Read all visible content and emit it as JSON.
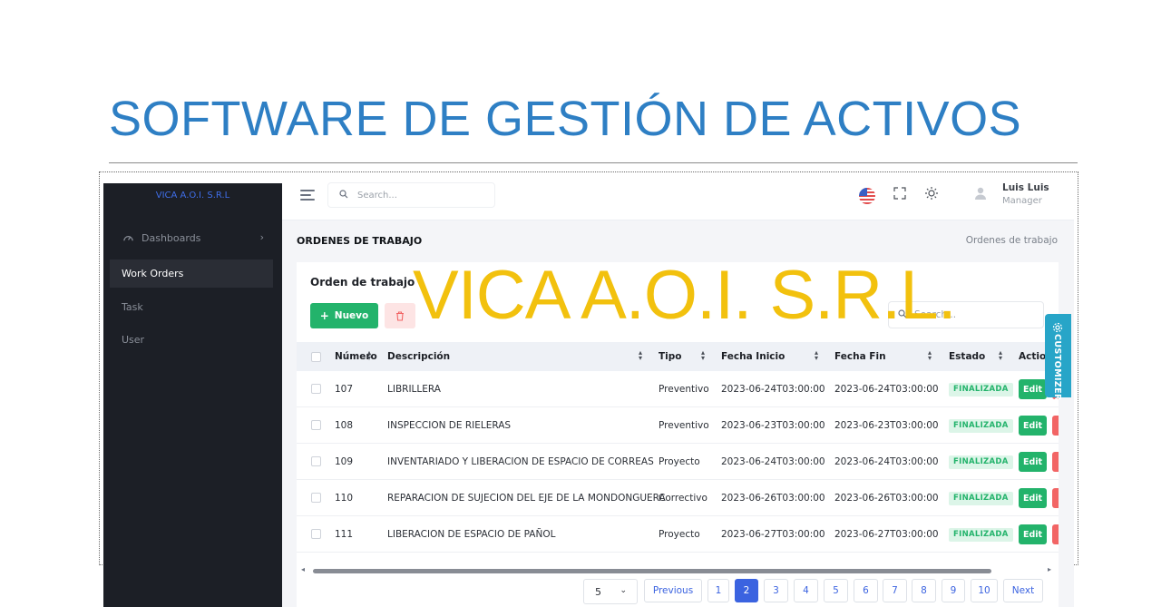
{
  "slide": {
    "title": "SOFTWARE DE GESTIÓN DE ACTIVOS",
    "watermark": "VICA A.O.I. S.R.L."
  },
  "sidebar": {
    "brand": "VICA A.O.I. S.R.L",
    "items": [
      {
        "label": "Dashboards",
        "icon": "gauge-icon"
      },
      {
        "label": "Work Orders",
        "active": true
      },
      {
        "label": "Task"
      },
      {
        "label": "User"
      }
    ]
  },
  "topbar": {
    "search_placeholder": "Search...",
    "user_name": "Luis Luis",
    "user_role": "Manager"
  },
  "page": {
    "title": "ORDENES DE TRABAJO",
    "breadcrumb": "Ordenes de trabajo"
  },
  "card": {
    "title": "Orden de trabajo",
    "new_button": "Nuevo",
    "search_placeholder": "Search...",
    "columns": [
      "Número",
      "Descripción",
      "Tipo",
      "Fecha Inicio",
      "Fecha Fin",
      "Estado",
      "Action"
    ],
    "rows": [
      {
        "numero": "107",
        "descripcion": "LIBRILLERA",
        "tipo": "Preventivo",
        "inicio": "2023-06-24T03:00:00",
        "fin": "2023-06-24T03:00:00",
        "estado": "FINALIZADA",
        "action": "Edit"
      },
      {
        "numero": "108",
        "descripcion": "INSPECCION DE RIELERAS",
        "tipo": "Preventivo",
        "inicio": "2023-06-23T03:00:00",
        "fin": "2023-06-23T03:00:00",
        "estado": "FINALIZADA",
        "action": "Edit"
      },
      {
        "numero": "109",
        "descripcion": "INVENTARIADO Y LIBERACION DE ESPACIO DE CORREAS",
        "tipo": "Proyecto",
        "inicio": "2023-06-24T03:00:00",
        "fin": "2023-06-24T03:00:00",
        "estado": "FINALIZADA",
        "action": "Edit"
      },
      {
        "numero": "110",
        "descripcion": "REPARACION DE SUJECION DEL EJE DE LA MONDONGUERA",
        "tipo": "Correctivo",
        "inicio": "2023-06-26T03:00:00",
        "fin": "2023-06-26T03:00:00",
        "estado": "FINALIZADA",
        "action": "Edit"
      },
      {
        "numero": "111",
        "descripcion": "LIBERACION DE ESPACIO DE PAÑOL",
        "tipo": "Proyecto",
        "inicio": "2023-06-27T03:00:00",
        "fin": "2023-06-27T03:00:00",
        "estado": "FINALIZADA",
        "action": "Edit"
      }
    ]
  },
  "pagination": {
    "page_size": "5",
    "previous": "Previous",
    "next": "Next",
    "pages": [
      "1",
      "2",
      "3",
      "4",
      "5",
      "6",
      "7",
      "8",
      "9",
      "10"
    ],
    "current": "2"
  },
  "customizer": {
    "label": "CUSTOMIZER"
  },
  "colors": {
    "title_blue": "#2e7fc4",
    "watermark_gold": "#f2c10e",
    "sidebar_bg": "#1c1f26",
    "success": "#23b36b",
    "primary": "#3b63e0",
    "customizer": "#27a5c8"
  }
}
